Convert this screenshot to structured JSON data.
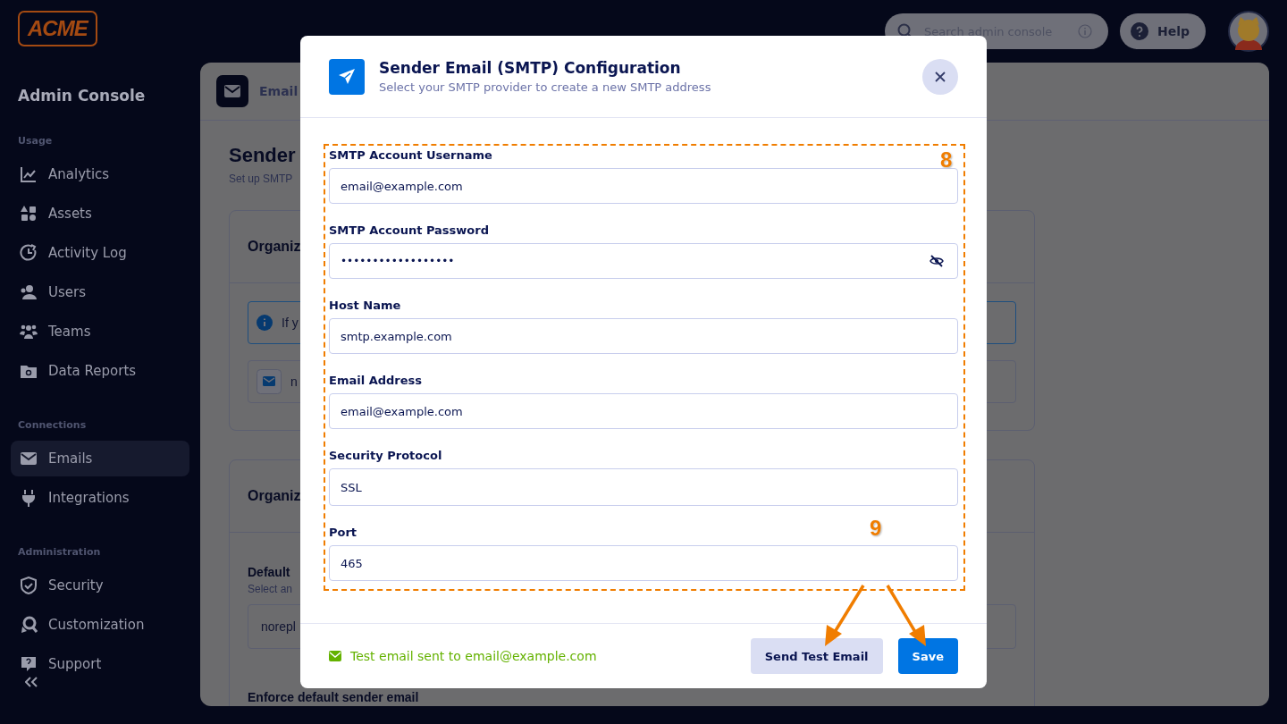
{
  "brand": {
    "logo": "ACME"
  },
  "sidebar": {
    "title": "Admin Console",
    "sections": [
      {
        "heading": "Usage",
        "items": [
          {
            "label": "Analytics",
            "selected": false
          },
          {
            "label": "Assets",
            "selected": false
          },
          {
            "label": "Activity Log",
            "selected": false
          },
          {
            "label": "Users",
            "selected": false
          },
          {
            "label": "Teams",
            "selected": false
          },
          {
            "label": "Data Reports",
            "selected": false
          }
        ]
      },
      {
        "heading": "Connections",
        "items": [
          {
            "label": "Emails",
            "selected": true
          },
          {
            "label": "Integrations",
            "selected": false
          }
        ]
      },
      {
        "heading": "Administration",
        "items": [
          {
            "label": "Security",
            "selected": false
          },
          {
            "label": "Customization",
            "selected": false
          },
          {
            "label": "Support",
            "selected": false
          }
        ]
      }
    ]
  },
  "header": {
    "search": {
      "placeholder": "Search admin console"
    },
    "help": "Help"
  },
  "page": {
    "tab_title": "Email",
    "title": "Sender",
    "subtitle": "Set up SMTP",
    "cards": [
      {
        "heading": "Organiz",
        "notice": "If y",
        "sender": "n"
      },
      {
        "heading": "Organiz",
        "field_label": "Default",
        "field_hint": "Select an",
        "select_value": "norepl",
        "option_label": "Enforce default sender email"
      }
    ]
  },
  "modal": {
    "title": "Sender Email (SMTP) Configuration",
    "subtitle": "Select your SMTP provider to create a new SMTP address",
    "fields": [
      {
        "label": "SMTP Account Username",
        "value": "email@example.com",
        "kind": "text"
      },
      {
        "label": "SMTP Account Password",
        "value": "••••••••••••••••••",
        "kind": "password"
      },
      {
        "label": "Host Name",
        "value": "smtp.example.com",
        "kind": "text"
      },
      {
        "label": "Email Address",
        "value": "email@example.com",
        "kind": "text"
      },
      {
        "label": "Security Protocol",
        "value": "SSL",
        "kind": "select"
      },
      {
        "label": "Port",
        "value": "465",
        "kind": "text"
      }
    ],
    "status": "Test email sent to email@example.com",
    "buttons": [
      {
        "label": "Send Test Email",
        "kind": "secondary"
      },
      {
        "label": "Save",
        "kind": "primary"
      }
    ]
  },
  "annotations": [
    {
      "label": "8",
      "kind": "box"
    },
    {
      "label": "9",
      "kind": "arrows"
    }
  ]
}
